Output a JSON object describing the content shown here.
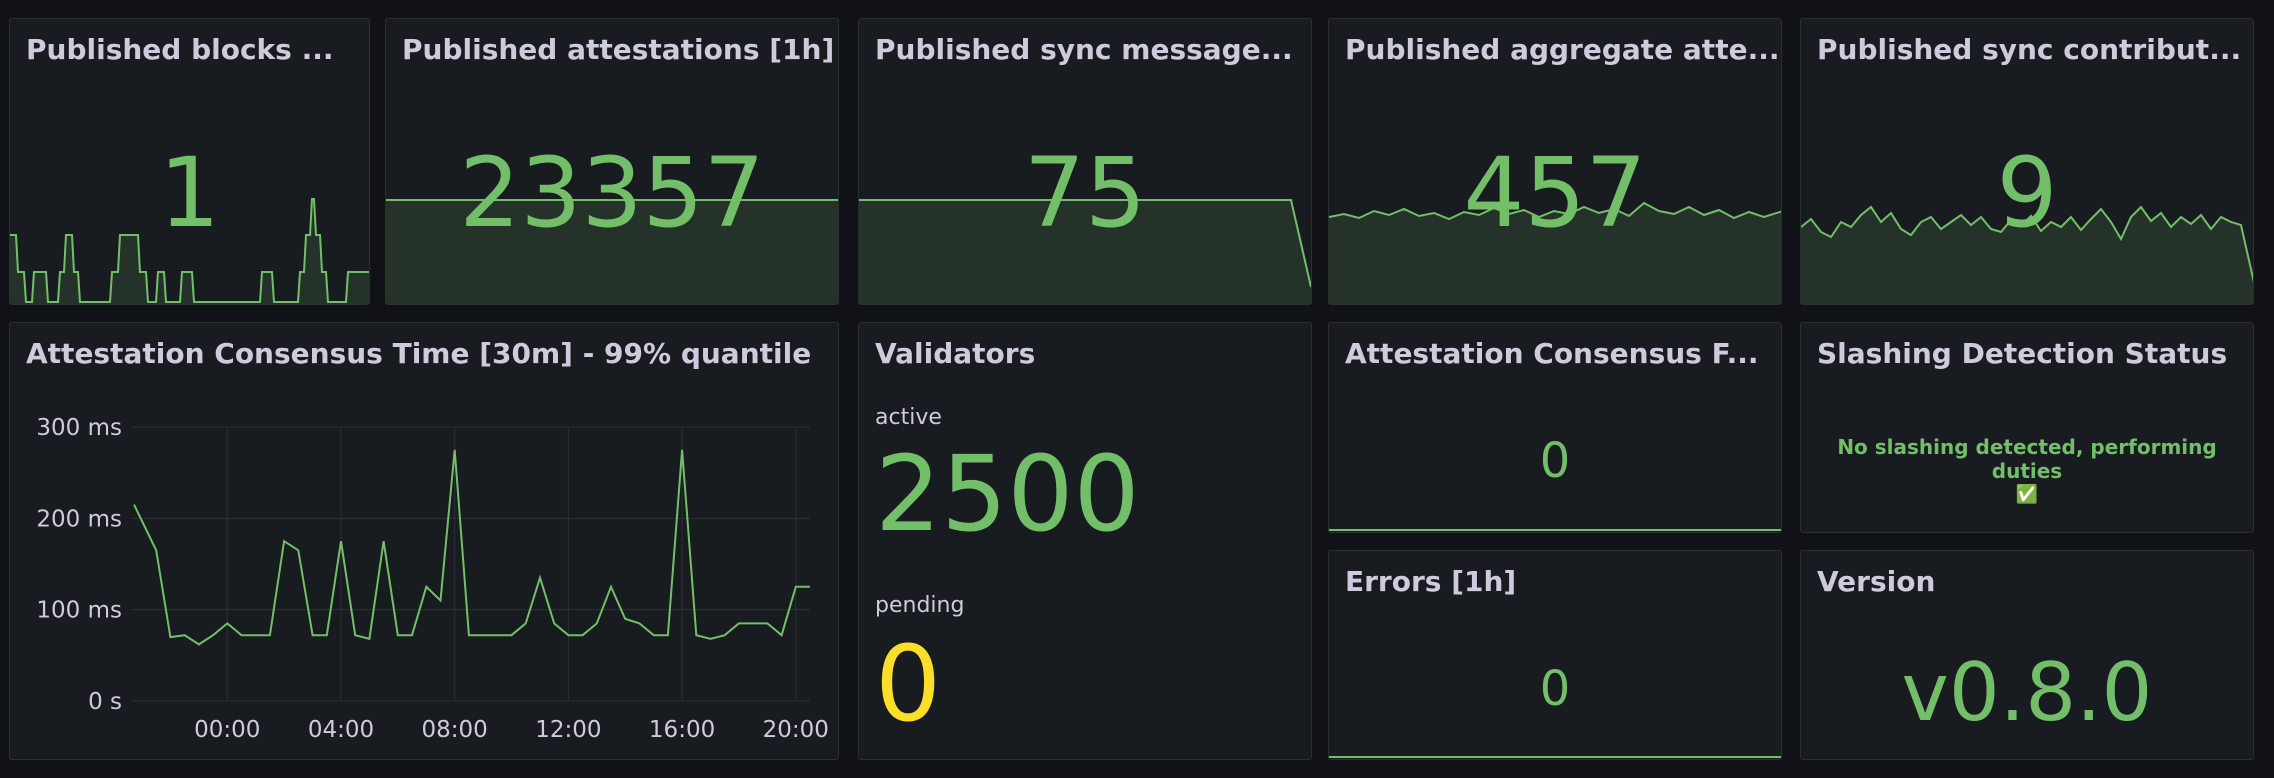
{
  "panels": {
    "blocks": {
      "title": "Published blocks ...",
      "value": "1"
    },
    "attestations": {
      "title": "Published attestations [1h]",
      "value": "23357"
    },
    "sync_messages": {
      "title": "Published sync message...",
      "value": "75"
    },
    "aggregate": {
      "title": "Published aggregate atte...",
      "value": "457"
    },
    "sync_contrib": {
      "title": "Published sync contribut...",
      "value": "9"
    },
    "consensus_time": {
      "title": "Attestation Consensus Time [30m] - 99% quantile",
      "y_ticks": [
        "300 ms",
        "200 ms",
        "100 ms",
        "0 s"
      ],
      "x_ticks": [
        "00:00",
        "04:00",
        "08:00",
        "12:00",
        "16:00",
        "20:00"
      ]
    },
    "validators": {
      "title": "Validators",
      "active_label": "active",
      "active_value": "2500",
      "pending_label": "pending",
      "pending_value": "0"
    },
    "consensus_failures": {
      "title": "Attestation Consensus F...",
      "value": "0"
    },
    "slashing": {
      "title": "Slashing Detection Status",
      "message": "No slashing detected, performing duties",
      "icon": "✅"
    },
    "errors": {
      "title": "Errors [1h]",
      "value": "0"
    },
    "version": {
      "title": "Version",
      "value": "v0.8.0"
    }
  },
  "colors": {
    "green": "#73bf69",
    "yellow": "#fade2a",
    "panel_bg": "#181b1f",
    "page_bg": "#111217"
  },
  "chart_data": {
    "type": "line",
    "ylabel": "",
    "xlabel": "",
    "ylim": [
      0,
      300
    ],
    "x": [
      "21:00",
      "21:30",
      "22:00",
      "22:30",
      "23:00",
      "23:30",
      "00:00",
      "00:30",
      "01:00",
      "01:30",
      "02:00",
      "02:30",
      "03:00",
      "03:30",
      "04:00",
      "04:30",
      "05:00",
      "05:30",
      "06:00",
      "06:30",
      "07:00",
      "07:30",
      "08:00",
      "08:30",
      "09:00",
      "09:30",
      "10:00",
      "10:30",
      "11:00",
      "11:30",
      "12:00",
      "12:30",
      "13:00",
      "13:30",
      "14:00",
      "14:30",
      "15:00",
      "15:30",
      "16:00",
      "16:30",
      "17:00",
      "17:30",
      "18:00",
      "18:30",
      "19:00",
      "19:30",
      "20:00",
      "20:30"
    ],
    "series": [
      {
        "values": [
          215,
          165,
          70,
          72,
          62,
          72,
          85,
          72,
          72,
          72,
          175,
          165,
          72,
          72,
          175,
          72,
          68,
          175,
          72,
          72,
          125,
          110,
          275,
          72,
          72,
          72,
          72,
          85,
          135,
          85,
          72,
          72,
          85,
          125,
          90,
          85,
          72,
          72,
          275,
          72,
          68,
          72,
          85,
          85,
          85,
          72,
          125,
          125
        ]
      }
    ]
  }
}
